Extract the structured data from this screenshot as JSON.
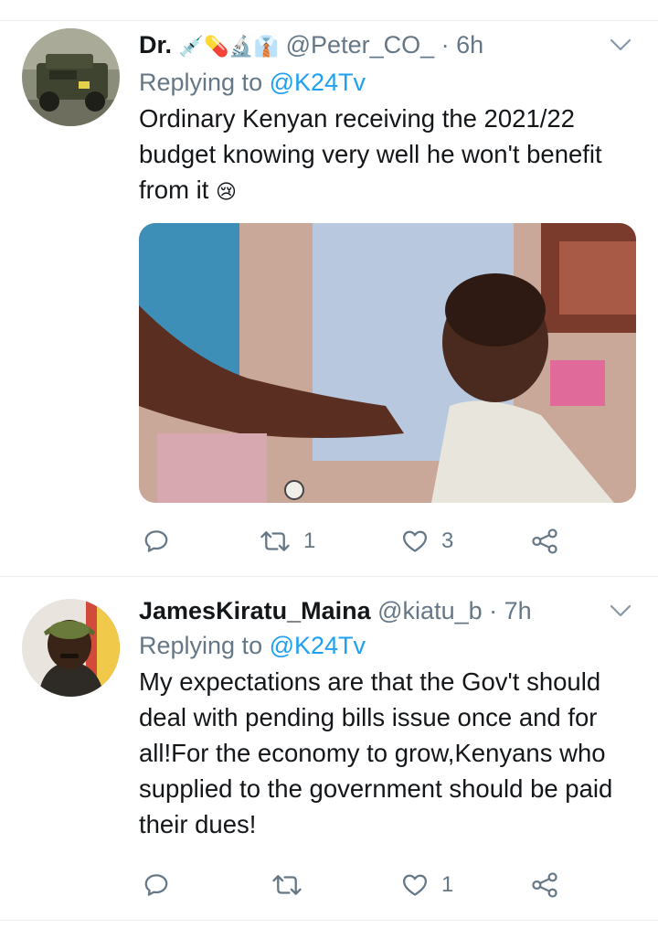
{
  "tweets": [
    {
      "display_name": "Dr.",
      "name_emojis": "💉💊🔬👔",
      "handle": "@Peter_CO_",
      "separator": "·",
      "time": "6h",
      "replying_prefix": "Replying to",
      "replying_to": "@K24Tv",
      "text": "Ordinary Kenyan receiving the 2021/22 budget knowing very well he won't benefit from it",
      "text_emoji": "😢",
      "retweets": "1",
      "likes": "3"
    },
    {
      "display_name": "JamesKiratu_Maina",
      "handle": "@kiatu_b",
      "separator": "·",
      "time": "7h",
      "replying_prefix": "Replying to",
      "replying_to": "@K24Tv",
      "text": "My expectations are that the Gov't should deal with pending bills issue once and for all!For the economy to grow,Kenyans who supplied to the government should be  paid their dues!",
      "retweets": "",
      "likes": "1"
    }
  ],
  "colors": {
    "text": "#14171a",
    "secondary": "#657786",
    "link": "#1da1f2",
    "divider": "#e6ecf0"
  }
}
